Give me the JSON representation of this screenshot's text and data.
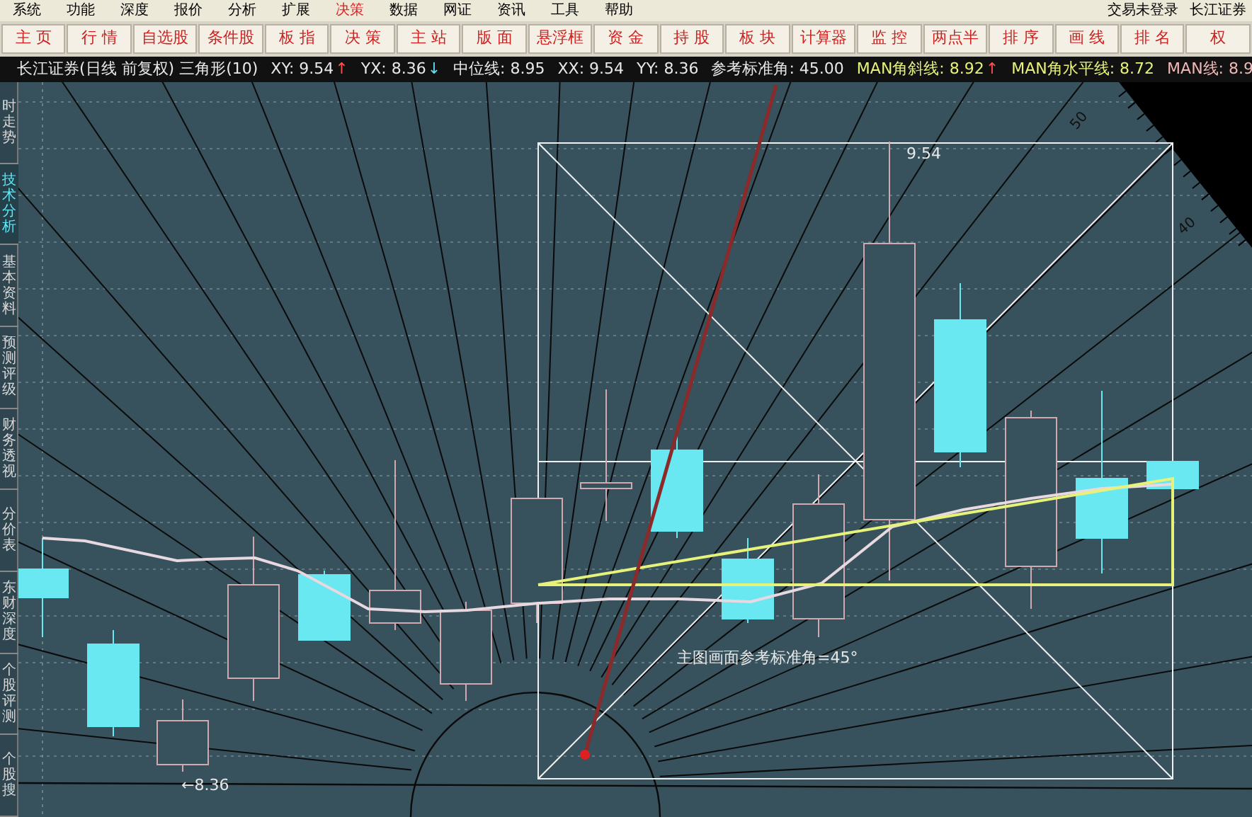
{
  "menu": {
    "items": [
      {
        "label": "系统",
        "selected": false
      },
      {
        "label": "功能",
        "selected": false
      },
      {
        "label": "深度",
        "selected": false
      },
      {
        "label": "报价",
        "selected": false
      },
      {
        "label": "分析",
        "selected": false
      },
      {
        "label": "扩展",
        "selected": false
      },
      {
        "label": "决策",
        "selected": true
      },
      {
        "label": "数据",
        "selected": false
      },
      {
        "label": "网证",
        "selected": false
      },
      {
        "label": "资讯",
        "selected": false
      },
      {
        "label": "工具",
        "selected": false
      },
      {
        "label": "帮助",
        "selected": false
      }
    ],
    "status": "交易未登录",
    "broker": "长江证券"
  },
  "toolbar": [
    "主 页",
    "行 情",
    "自选股",
    "条件股",
    "板 指",
    "决 策",
    "主 站",
    "版 面",
    "悬浮框",
    "资 金",
    "持 股",
    "板 块",
    "计算器",
    "监 控",
    "两点半",
    "排 序",
    "画 线",
    "排 名",
    "权"
  ],
  "info_bar": {
    "title": "长江证券(日线 前复权) 三角形(10)",
    "items": [
      {
        "text": "XY: 9.54",
        "arrow": "↑",
        "kind": "plain"
      },
      {
        "text": "YX: 8.36",
        "arrow": "↓",
        "kind": "plain"
      },
      {
        "text": "中位线: 8.95",
        "kind": "plain"
      },
      {
        "text": "XX: 9.54",
        "kind": "plain"
      },
      {
        "text": "YY: 8.36",
        "kind": "plain"
      },
      {
        "text": "参考标准角: 45.00",
        "kind": "plain"
      },
      {
        "text": "MAN角斜线: 8.92",
        "arrow": "↑",
        "kind": "man"
      },
      {
        "text": "MAN角水平线: 8.72",
        "kind": "man"
      },
      {
        "text": "MAN线: 8.9",
        "kind": "man_line"
      }
    ]
  },
  "sidebar": {
    "items": [
      {
        "label": "时走势",
        "selected": false
      },
      {
        "label": "技术分析",
        "selected": true
      },
      {
        "label": "基本资料",
        "selected": false
      },
      {
        "label": "预测评级",
        "selected": false
      },
      {
        "label": "财务透视",
        "selected": false
      },
      {
        "label": "分价表",
        "selected": false
      },
      {
        "label": "东财深度",
        "selected": false
      },
      {
        "label": "个股评测",
        "selected": false
      },
      {
        "label": "个股搜",
        "selected": false
      }
    ]
  },
  "chart": {
    "high_label": "9.54",
    "low_label": "←8.36",
    "angle_note": "主图画面参考标准角=45°",
    "protractor_labels": [
      "50",
      "40"
    ]
  }
}
